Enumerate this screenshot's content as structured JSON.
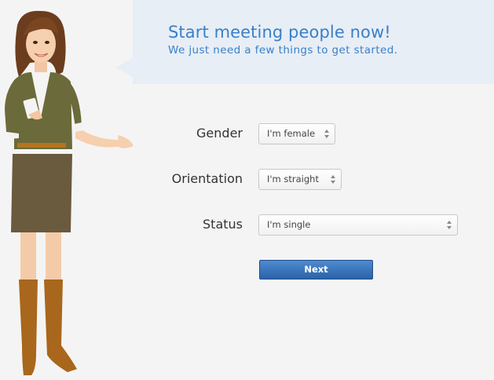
{
  "header": {
    "headline": "Start meeting people now!",
    "subline": "We just need a few things to get started."
  },
  "form": {
    "gender": {
      "label": "Gender",
      "value": "I'm female"
    },
    "orientation": {
      "label": "Orientation",
      "value": "I'm straight"
    },
    "status": {
      "label": "Status",
      "value": "I'm single"
    },
    "next_label": "Next"
  },
  "colors": {
    "accent": "#3a7fc8",
    "bubble": "#e7eef6",
    "button": "#2a62a8",
    "background": "#f5f4f4"
  }
}
